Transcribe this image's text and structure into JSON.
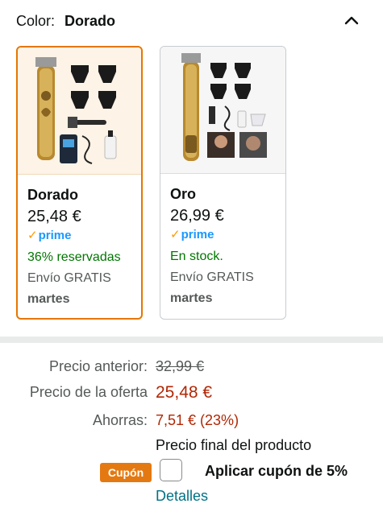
{
  "header": {
    "label": "Color:",
    "value": "Dorado",
    "toggle_icon": "chevron-up-icon"
  },
  "variants": [
    {
      "name": "Dorado",
      "price": "25,48 €",
      "prime": "prime",
      "availability": "36% reservadas",
      "shipping": "Envío GRATIS",
      "delivery_day": "martes",
      "selected": true
    },
    {
      "name": "Oro",
      "price": "26,99 €",
      "prime": "prime",
      "availability": "En stock.",
      "shipping": "Envío GRATIS",
      "delivery_day": "martes",
      "selected": false
    }
  ],
  "pricing": {
    "previous_label": "Precio anterior:",
    "previous_value": "32,99 €",
    "offer_label": "Precio de la oferta",
    "offer_value": "25,48 €",
    "savings_label": "Ahorras:",
    "savings_value": "7,51 € (23%)"
  },
  "coupon": {
    "final_text": "Precio final del producto",
    "badge": "Cupón",
    "label": "Aplicar cupón de 5%",
    "details_link": "Detalles"
  },
  "colors": {
    "accent": "#e77600",
    "price_red": "#b12704",
    "stock_green": "#007600",
    "prime_blue": "#1a98ff",
    "link": "#007185",
    "badge": "#e47911"
  }
}
